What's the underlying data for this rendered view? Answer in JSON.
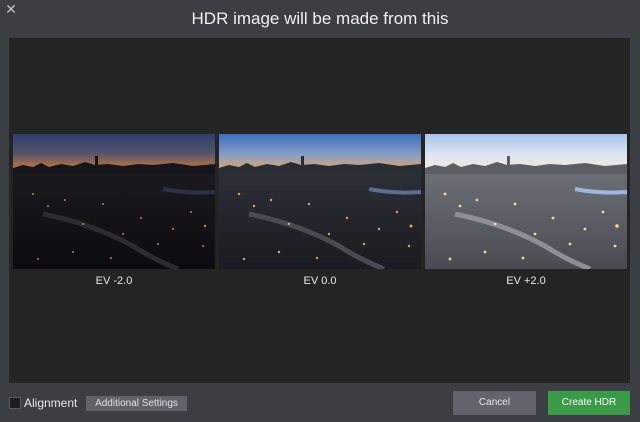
{
  "dialog": {
    "title": "HDR image will be made from this",
    "close_icon": "close-icon"
  },
  "images": [
    {
      "label": "EV -2.0",
      "exposure": "under"
    },
    {
      "label": "EV 0.0",
      "exposure": "normal"
    },
    {
      "label": "EV +2.0",
      "exposure": "over"
    }
  ],
  "footer": {
    "alignment_label": "Alignment",
    "alignment_checked": false,
    "additional_settings_label": "Additional Settings",
    "cancel_label": "Cancel",
    "create_label": "Create HDR"
  },
  "colors": {
    "accent_green": "#3a9a48",
    "dialog_bg": "#3b3e42",
    "panel_bg": "#242424"
  }
}
